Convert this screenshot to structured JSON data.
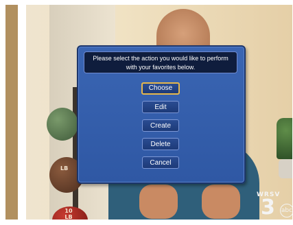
{
  "dialog": {
    "message_line1": "Please select the action you would like to perform",
    "message_line2": "with your favorites below.",
    "buttons": [
      {
        "label": "Choose",
        "focused": true
      },
      {
        "label": "Edit"
      },
      {
        "label": "Create"
      },
      {
        "label": "Delete"
      },
      {
        "label": "Cancel"
      }
    ]
  },
  "background": {
    "ball_labels": [
      "LB",
      "10 LB"
    ],
    "station": {
      "call_sign": "WRSV",
      "channel": "3",
      "network": "abc"
    }
  }
}
